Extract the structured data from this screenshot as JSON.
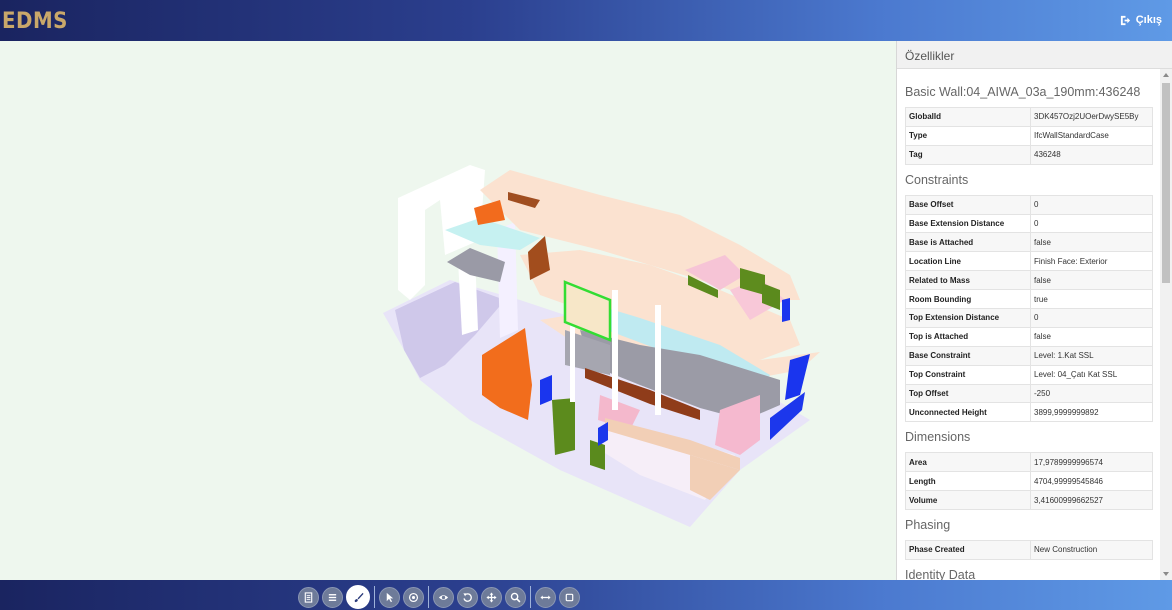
{
  "app": {
    "brand": "EDMS",
    "logout_label": "Çıkış"
  },
  "panel": {
    "header": "Özellikler",
    "element_title": "Basic Wall:04_AIWA_03a_190mm:436248",
    "identity_rows": [
      {
        "key": "GlobalId",
        "value": "3DK457Ozj2UOerDwySE5By"
      },
      {
        "key": "Type",
        "value": "IfcWallStandardCase"
      },
      {
        "key": "Tag",
        "value": "436248"
      }
    ],
    "sections": [
      {
        "title": "Constraints",
        "rows": [
          {
            "key": "Base Offset",
            "value": "0"
          },
          {
            "key": "Base Extension Distance",
            "value": "0"
          },
          {
            "key": "Base is Attached",
            "value": "false"
          },
          {
            "key": "Location Line",
            "value": "Finish Face: Exterior"
          },
          {
            "key": "Related to Mass",
            "value": "false"
          },
          {
            "key": "Room Bounding",
            "value": "true"
          },
          {
            "key": "Top Extension Distance",
            "value": "0"
          },
          {
            "key": "Top is Attached",
            "value": "false"
          },
          {
            "key": "Base Constraint",
            "value": "Level: 1.Kat SSL"
          },
          {
            "key": "Top Constraint",
            "value": "Level: 04_Çatı Kat SSL"
          },
          {
            "key": "Top Offset",
            "value": "-250"
          },
          {
            "key": "Unconnected Height",
            "value": "3899,9999999892"
          }
        ]
      },
      {
        "title": "Dimensions",
        "rows": [
          {
            "key": "Area",
            "value": "17,9789999996574"
          },
          {
            "key": "Length",
            "value": "4704,99999545846"
          },
          {
            "key": "Volume",
            "value": "3,41600999662527"
          }
        ]
      },
      {
        "title": "Phasing",
        "rows": [
          {
            "key": "Phase Created",
            "value": "New Construction"
          }
        ]
      },
      {
        "title": "Identity Data",
        "rows": []
      }
    ]
  },
  "toolbar": {
    "buttons": [
      {
        "name": "document-icon-button",
        "icon": "document-icon"
      },
      {
        "name": "menu-icon-button",
        "icon": "list-icon"
      },
      {
        "name": "brush-icon-button",
        "icon": "paint-brush-icon",
        "active": true
      },
      {
        "name": "select-icon-button",
        "icon": "cursor-icon"
      },
      {
        "name": "target-icon-button",
        "icon": "target-icon"
      },
      {
        "name": "view-icon-button",
        "icon": "eye-icon"
      },
      {
        "name": "rotate-icon-button",
        "icon": "rotate-icon"
      },
      {
        "name": "pan-icon-button",
        "icon": "move-icon"
      },
      {
        "name": "zoom-icon-button",
        "icon": "search-icon"
      },
      {
        "name": "measure-icon-button",
        "icon": "horizontal-arrows-icon"
      },
      {
        "name": "fit-icon-button",
        "icon": "square-icon"
      }
    ]
  },
  "colors": {
    "viewer_background": "#eef7ee",
    "selected_outline": "#33dd33",
    "brand_text": "#c9a86a"
  }
}
